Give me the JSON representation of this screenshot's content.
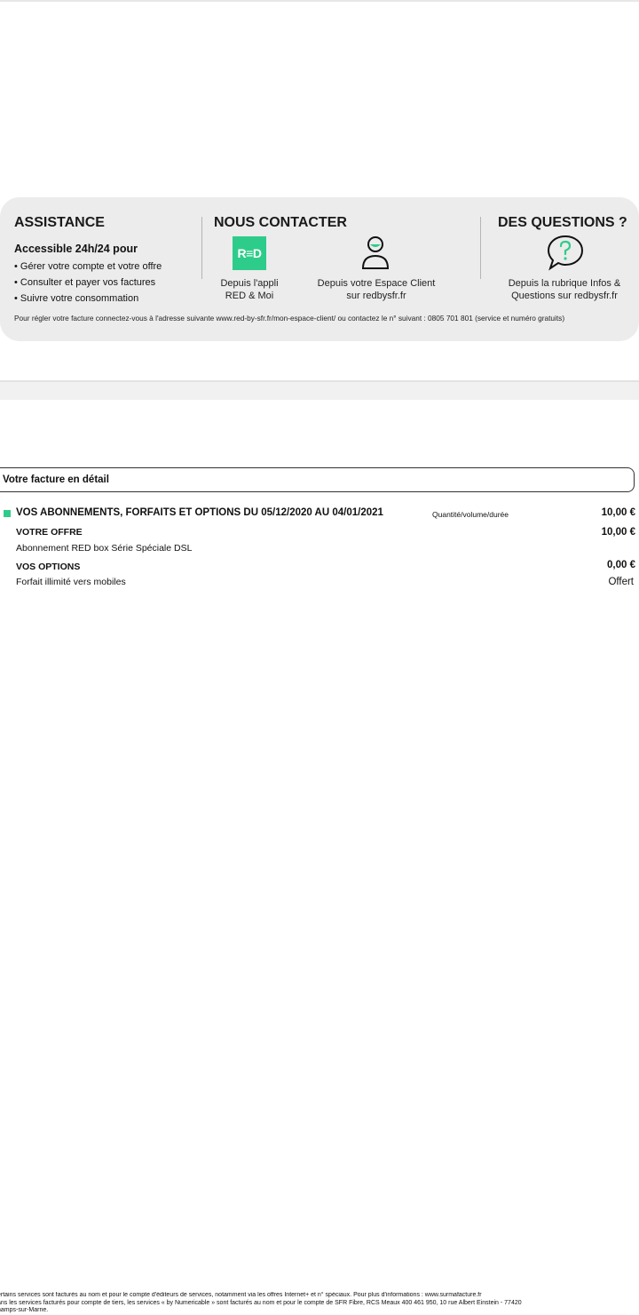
{
  "assistance": {
    "title": "ASSISTANCE",
    "subtitle": "Accessible 24h/24 pour",
    "items": [
      "Gérer votre compte et votre offre",
      "Consulter et payer vos factures",
      "Suivre votre consommation"
    ]
  },
  "contact": {
    "title": "NOUS CONTACTER",
    "app_logo_text": "R≡D",
    "app_caption_line1": "Depuis l'appli",
    "app_caption_line2": "RED & Moi",
    "client_caption_line1": "Depuis votre Espace Client",
    "client_caption_line2": "sur redbysfr.fr",
    "app_icon": "red-app-icon",
    "client_icon": "user-icon"
  },
  "questions": {
    "title": "DES QUESTIONS ?",
    "caption_line1": "Depuis la rubrique Infos &",
    "caption_line2": "Questions sur redbysfr.fr",
    "icon": "question-bubble-icon"
  },
  "assist_footnote": "Pour régler votre facture connectez-vous à l'adresse suivante www.red-by-sfr.fr/mon-espace-client/ ou contactez le n° suivant : 0805 701 801 (service et numéro gratuits)",
  "detail": {
    "title": "Votre facture en détail",
    "section_title": "VOS ABONNEMENTS, FORFAITS ET OPTIONS DU 05/12/2020 AU 04/01/2021",
    "qty_label": "Quantité/volume/durée",
    "section_amount": "10,00 €",
    "offer_title": "VOTRE OFFRE",
    "offer_amount": "10,00 €",
    "offer_item": "Abonnement RED box Série Spéciale DSL",
    "options_title": "VOS OPTIONS",
    "options_amount": "0,00 €",
    "options_item": "Forfait illimité vers mobiles",
    "options_item_value": "Offert"
  },
  "footer": {
    "line1": "ertains services sont facturés au nom et pour le compte d'éditeurs de services, notamment via les offres Internet+ et n° spéciaux. Pour plus d'informations : www.surmafacture.fr",
    "line2": "ans les services facturés pour compte de tiers, les services « by Numericable » sont facturés au nom et pour le compte de SFR Fibre, RCS Meaux 400 461 950, 10 rue Albert Einstein - 77420",
    "line3": "hamps-sur-Marne."
  },
  "colors": {
    "accent_green": "#2ecc8a",
    "panel_grey": "#ececec"
  }
}
